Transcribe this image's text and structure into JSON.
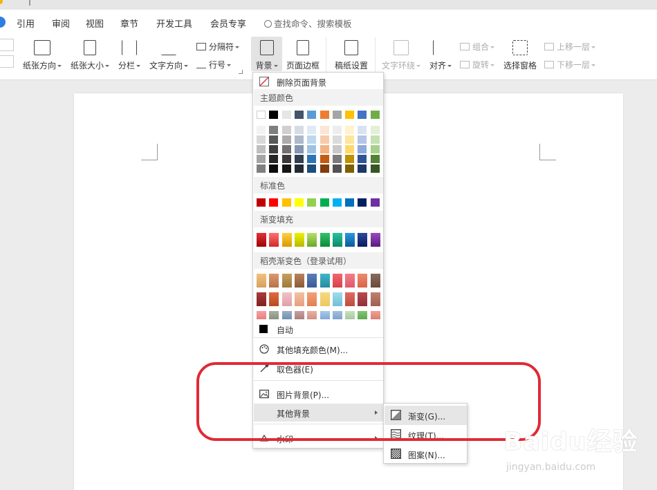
{
  "menu_tabs": [
    "引用",
    "审阅",
    "视图",
    "章节",
    "开发工具",
    "会员专享"
  ],
  "search": {
    "label": "查找命令、搜索模板"
  },
  "ribbon": {
    "orientation": "纸张方向",
    "size": "纸张大小",
    "columns": "分栏",
    "text_direction": "文字方向",
    "separator": "分隔符",
    "line_number": "行号",
    "background": "背景",
    "page_border": "页面边框",
    "paper_setup": "稿纸设置",
    "wrap_text": "文字环绕",
    "align": "对齐",
    "group": "组合",
    "rotate": "旋转",
    "select_pane": "选择窗格",
    "bring_forward": "上移一层",
    "send_backward": "下移一层"
  },
  "dropdown": {
    "delete_bg": "删除页面背景",
    "theme_colors_hdr": "主题颜色",
    "standard_colors_hdr": "标准色",
    "gradient_fill_hdr": "渐变填充",
    "daoke_gradient_hdr": "稻壳渐变色（登录试用）",
    "auto": "自动",
    "more_fill": "其他填充颜色(M)...",
    "eyedropper": "取色器(E)",
    "picture_bg": "图片背景(P)...",
    "other_bg": "其他背景",
    "watermark": "水印"
  },
  "submenu": {
    "gradient": "渐变(G)...",
    "texture": "纹理(T)...",
    "pattern": "图案(N)..."
  },
  "colors": {
    "theme_top": [
      "#ffffff",
      "#000000",
      "#e7e6e6",
      "#44546a",
      "#5b9bd5",
      "#ed7d31",
      "#a5a5a5",
      "#ffc000",
      "#4472c4",
      "#70ad47"
    ],
    "theme_shades": [
      [
        "#f2f2f2",
        "#7f7f7f",
        "#d0cece",
        "#d6dce4",
        "#deebf6",
        "#fbe5d5",
        "#ededed",
        "#fff2cc",
        "#d9e2f3",
        "#e2efd9"
      ],
      [
        "#d8d8d8",
        "#595959",
        "#aeabab",
        "#adb9ca",
        "#bdd7ee",
        "#f7cbac",
        "#dbdbdb",
        "#fee599",
        "#b4c6e7",
        "#c5e0b3"
      ],
      [
        "#bfbfbf",
        "#3f3f3f",
        "#757070",
        "#8496b0",
        "#9cc3e5",
        "#f4b183",
        "#c9c9c9",
        "#ffd966",
        "#8eaadb",
        "#a8d08d"
      ],
      [
        "#a5a5a5",
        "#262626",
        "#3a3838",
        "#323f4f",
        "#2e75b5",
        "#c55a11",
        "#7b7b7b",
        "#bf9000",
        "#2f5496",
        "#538135"
      ],
      [
        "#7f7f7f",
        "#0c0c0c",
        "#171616",
        "#222a35",
        "#1e4e79",
        "#833c0b",
        "#525252",
        "#7f6000",
        "#1f3864",
        "#375623"
      ]
    ],
    "standard": [
      "#c00000",
      "#ff0000",
      "#ffc000",
      "#ffff00",
      "#92d050",
      "#00b050",
      "#00b0f0",
      "#0070c0",
      "#002060",
      "#7030a0"
    ],
    "gradient": [
      [
        "#e0323a",
        "#a00000"
      ],
      [
        "#ff7070",
        "#d22a2a"
      ],
      [
        "#ffd040",
        "#d89a00"
      ],
      [
        "#eef000",
        "#b8b800"
      ],
      [
        "#b5e06a",
        "#6aa728"
      ],
      [
        "#37c06a",
        "#0a8a3a"
      ],
      [
        "#2ac0a0",
        "#0a8a68"
      ],
      [
        "#2a98e0",
        "#0a5a9a"
      ],
      [
        "#2a4aa0",
        "#0a1a60"
      ],
      [
        "#9a4ac0",
        "#5a1a80"
      ]
    ],
    "daoke": [
      [
        [
          "#f3c17b",
          "#d6a060"
        ],
        [
          "#d99a6c",
          "#b87048"
        ],
        [
          "#c8a060",
          "#9a7a3a"
        ],
        [
          "#b8845a",
          "#8a5a38"
        ],
        [
          "#5b7fba",
          "#3a5a96"
        ],
        [
          "#3fb7c8",
          "#2a8aa0"
        ],
        [
          "#f26770",
          "#d8404a"
        ],
        [
          "#f37c8c",
          "#e05a6a"
        ],
        [
          "#ef8a6a",
          "#d8664a"
        ],
        [
          "#8a6a5a",
          "#6a4a3a"
        ]
      ],
      [
        [
          "#a83b3b",
          "#802020"
        ],
        [
          "#e06a40",
          "#b84a20"
        ],
        [
          "#f3c0c8",
          "#e0a0a8"
        ],
        [
          "#f5c0a0",
          "#e6a080"
        ],
        [
          "#f3a07a",
          "#e08050"
        ],
        [
          "#f5d880",
          "#ecc860"
        ],
        [
          "#a0dcec",
          "#70c0d8"
        ],
        [
          "#e06a60",
          "#c04a40"
        ],
        [
          "#b84a50",
          "#903038"
        ],
        [
          "#c08070",
          "#a06050"
        ]
      ],
      [
        [
          "#f5a0a0",
          "#e58080"
        ],
        [
          "#a8b0a0",
          "#889080"
        ],
        [
          "#9ab0c8",
          "#7090b0"
        ],
        [
          "#c8a0a0",
          "#a88080"
        ],
        [
          "#e8b0a0",
          "#d09080"
        ],
        [
          "#a8c8e8",
          "#80a8d8"
        ],
        [
          "#a0c0e0",
          "#80a0c8"
        ],
        [
          "#c8e0c0",
          "#a8c8a0"
        ],
        [
          "#80c870",
          "#60a850"
        ],
        [
          "#f0a090",
          "#d88070"
        ]
      ]
    ],
    "annotation": "#e02a35"
  },
  "watermark": {
    "logo": "Baidu经验",
    "url": "jingyan.baidu.com"
  }
}
